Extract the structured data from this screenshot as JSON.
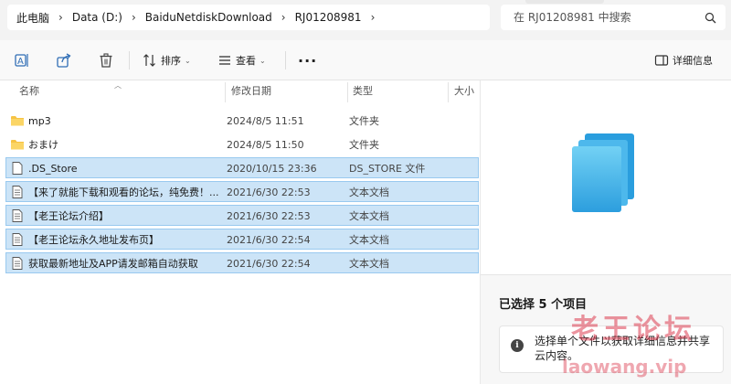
{
  "breadcrumb": [
    "此电脑",
    "Data (D:)",
    "BaiduNetdiskDownload",
    "RJ01208981"
  ],
  "search": {
    "placeholder": "在 RJ01208981 中搜索"
  },
  "toolbar": {
    "sort_label": "排序",
    "view_label": "查看",
    "details_label": "详细信息"
  },
  "columns": {
    "name": "名称",
    "modified": "修改日期",
    "type": "类型",
    "size": "大小"
  },
  "files": [
    {
      "name": "mp3",
      "modified": "2024/8/5 11:51",
      "type": "文件夹",
      "icon": "folder-icon",
      "selected": false
    },
    {
      "name": "おまけ",
      "modified": "2024/8/5 11:50",
      "type": "文件夹",
      "icon": "folder-icon",
      "selected": false
    },
    {
      "name": ".DS_Store",
      "modified": "2020/10/15 23:36",
      "type": "DS_STORE 文件",
      "icon": "file-icon",
      "selected": true
    },
    {
      "name": "【来了就能下载和观看的论坛，纯免费！...",
      "modified": "2021/6/30 22:53",
      "type": "文本文档",
      "icon": "text-file-icon",
      "selected": true
    },
    {
      "name": "【老王论坛介绍】",
      "modified": "2021/6/30 22:53",
      "type": "文本文档",
      "icon": "text-file-icon",
      "selected": true
    },
    {
      "name": "【老王论坛永久地址发布页】",
      "modified": "2021/6/30 22:54",
      "type": "文本文档",
      "icon": "text-file-icon",
      "selected": true
    },
    {
      "name": "获取最新地址及APP请发邮箱自动获取",
      "modified": "2021/6/30 22:54",
      "type": "文本文档",
      "icon": "text-file-icon",
      "selected": true
    }
  ],
  "details": {
    "selection_count": "已选择 5 个项目",
    "hint": "选择单个文件以获取详细信息并共享云内容。"
  },
  "watermark": {
    "line1": "老王论坛",
    "line2": "laowang.vip"
  },
  "colors": {
    "selection": "#cce4f7",
    "selection_border": "#99c9ef",
    "folder": "#f6c344",
    "accent": "#2e9fe6"
  }
}
